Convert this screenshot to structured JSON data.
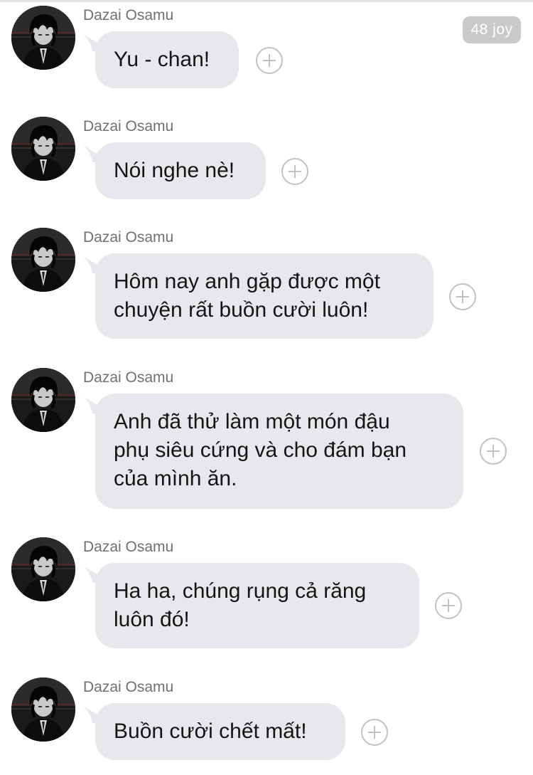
{
  "badge": "48 joy",
  "messages": [
    {
      "sender": "Dazai Osamu",
      "lines": [
        "Yu - chan!"
      ]
    },
    {
      "sender": "Dazai Osamu",
      "lines": [
        "Nói nghe nè!"
      ]
    },
    {
      "sender": "Dazai Osamu",
      "lines": [
        "Hôm nay anh gặp được một",
        "chuyện rất buồn cười luôn!"
      ]
    },
    {
      "sender": "Dazai Osamu",
      "lines": [
        "Anh đã thử làm một món đậu",
        "phụ siêu cứng và cho đám bạn",
        "của mình ăn."
      ]
    },
    {
      "sender": "Dazai Osamu",
      "lines": [
        "Ha ha, chúng rụng cả răng",
        "luôn đó!"
      ]
    },
    {
      "sender": "Dazai Osamu",
      "lines": [
        "Buồn cười chết mất!"
      ]
    }
  ],
  "icons": {
    "avatar": "avatar-portrait",
    "react": "add-reaction-icon"
  },
  "colors": {
    "bubble": "#e6e8eb",
    "badge": "#c9c9c9",
    "sender": "#707070"
  }
}
